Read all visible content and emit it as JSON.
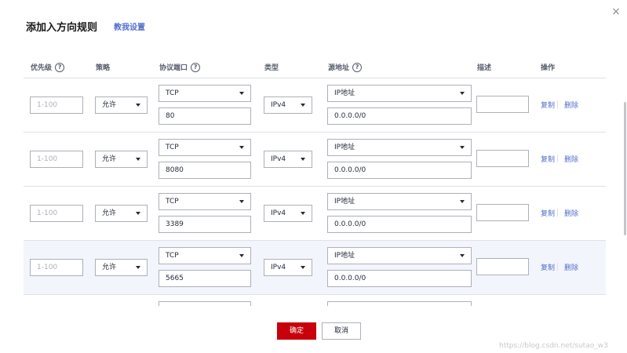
{
  "dialog": {
    "title": "添加入方向规则",
    "help_link": "教我设置",
    "close_glyph": "×"
  },
  "table": {
    "headers": {
      "priority": "优先级",
      "policy": "策略",
      "protocol_port": "协议端口",
      "type": "类型",
      "source": "源地址",
      "description": "描述",
      "action": "操作"
    },
    "help_glyph": "?",
    "rows": [
      {
        "priority_placeholder": "1-100",
        "policy": "允许",
        "protocol": "TCP",
        "port": "80",
        "type": "IPv4",
        "source_type": "IP地址",
        "source_ip": "0.0.0.0/0",
        "copy": "复制",
        "delete": "删除"
      },
      {
        "priority_placeholder": "1-100",
        "policy": "允许",
        "protocol": "TCP",
        "port": "8080",
        "type": "IPv4",
        "source_type": "IP地址",
        "source_ip": "0.0.0.0/0",
        "copy": "复制",
        "delete": "删除"
      },
      {
        "priority_placeholder": "1-100",
        "policy": "允许",
        "protocol": "TCP",
        "port": "3389",
        "type": "IPv4",
        "source_type": "IP地址",
        "source_ip": "0.0.0.0/0",
        "copy": "复制",
        "delete": "删除"
      },
      {
        "priority_placeholder": "1-100",
        "policy": "允许",
        "protocol": "TCP",
        "port": "5665",
        "type": "IPv4",
        "source_type": "IP地址",
        "source_ip": "0.0.0.0/0",
        "copy": "复制",
        "delete": "删除"
      }
    ]
  },
  "footer": {
    "confirm": "确定",
    "cancel": "取消"
  },
  "watermark": "https://blog.csdn.net/sutao_w3",
  "colors": {
    "accent_link": "#526ecc",
    "primary_button": "#c7000b",
    "highlight_row": "#f3f5fc"
  }
}
